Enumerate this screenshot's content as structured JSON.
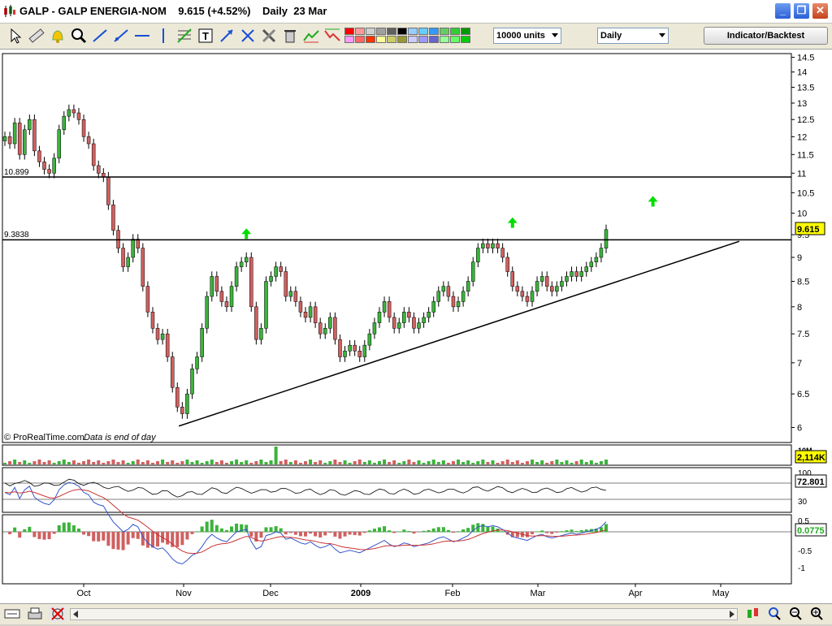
{
  "window": {
    "title": "GALP - GALP ENERGIA-NOM    9.615 (+4.52%)    Daily  23 Mar",
    "minimize_label": "_",
    "restore_label": "❐",
    "close_label": "✕"
  },
  "toolbar": {
    "tools": [
      "pointer-icon",
      "ruler-icon",
      "alarm-bell-icon",
      "zoom-icon",
      "line-tool-icon",
      "ray-tool-icon",
      "horizontal-line-icon",
      "vertical-line-icon",
      "fibonacci-icon",
      "text-tool-icon",
      "arrows-icon",
      "crosshair-icon",
      "tools-icon",
      "trash-icon",
      "trend-up-icon",
      "trend-down-icon"
    ],
    "swatch_colors": [
      "#ff0000",
      "#ff9999",
      "#d0d0d0",
      "#a0a0a0",
      "#606060",
      "#000000",
      "#99ccff",
      "#66ccff",
      "#3399ff",
      "#66cc66",
      "#33cc33",
      "#009900",
      "#ff99ff",
      "#ff6666",
      "#ff3300",
      "#ffff99",
      "#cccc66",
      "#999933",
      "#ccccff",
      "#9999ff",
      "#6666cc",
      "#99ff99",
      "#66ff66",
      "#00cc00"
    ],
    "units_select": "10000 units",
    "period_select": "Daily",
    "indicator_button": "Indicator/Backtest"
  },
  "chart_data": [
    {
      "type": "candlestick",
      "title": "GALP - GALP ENERGIA-NOM",
      "last_price": "9.615",
      "change": "+4.52%",
      "period": "Daily",
      "date_label": "23 Mar",
      "ylim": [
        5.8,
        14.6
      ],
      "y_scale": "log",
      "y_ticks": [
        "14.5",
        "14",
        "13.5",
        "13",
        "12.5",
        "12",
        "11.5",
        "11",
        "10.5",
        "10",
        "9.5",
        "9",
        "8.5",
        "8",
        "7.5",
        "7",
        "6.5",
        "6"
      ],
      "x_labels": [
        "Oct",
        "Nov",
        "Dec",
        "2009",
        "Feb",
        "Mar",
        "Apr",
        "May"
      ],
      "horizontal_lines": [
        {
          "label": "10.899",
          "value": 10.9
        },
        {
          "label": "9.3838",
          "value": 9.3838
        }
      ],
      "trendline": {
        "from": [
          "2008-11-24",
          6.02
        ],
        "to": [
          "2009-04-20",
          9.35
        ]
      },
      "arrow_markers": [
        "2008-11-18",
        "2009-02-16",
        "2009-03-24"
      ],
      "price_badge": "9.615",
      "watermark": "© ProRealTime.com",
      "note": "Data is end of day",
      "close_series": [
        12.0,
        11.8,
        12.4,
        11.5,
        12.2,
        12.5,
        11.6,
        11.3,
        11.1,
        11.0,
        11.4,
        12.2,
        12.6,
        12.8,
        12.7,
        12.5,
        12.0,
        11.8,
        11.2,
        11.0,
        10.9,
        10.2,
        9.6,
        9.2,
        8.8,
        9.0,
        9.4,
        9.2,
        8.4,
        7.9,
        7.6,
        7.4,
        7.5,
        7.1,
        6.6,
        6.3,
        6.2,
        6.5,
        6.9,
        7.1,
        7.6,
        8.2,
        8.6,
        8.3,
        8.1,
        8.0,
        8.4,
        8.8,
        8.9,
        9.0,
        8.0,
        7.4,
        7.6,
        8.5,
        8.6,
        8.8,
        8.7,
        8.2,
        8.3,
        8.1,
        7.9,
        7.8,
        8.0,
        7.7,
        7.5,
        7.6,
        7.8,
        7.4,
        7.1,
        7.2,
        7.3,
        7.2,
        7.1,
        7.3,
        7.5,
        7.7,
        7.9,
        8.1,
        7.8,
        7.6,
        7.7,
        7.9,
        7.8,
        7.6,
        7.7,
        7.8,
        7.9,
        8.1,
        8.3,
        8.4,
        8.2,
        8.0,
        8.1,
        8.3,
        8.5,
        8.9,
        9.2,
        9.3,
        9.2,
        9.3,
        9.2,
        9.0,
        8.7,
        8.4,
        8.3,
        8.2,
        8.1,
        8.3,
        8.5,
        8.6,
        8.4,
        8.3,
        8.4,
        8.5,
        8.6,
        8.7,
        8.6,
        8.7,
        8.8,
        8.9,
        9.0,
        9.2,
        9.615
      ],
      "volume_label": "10M",
      "volume_badge": "2,114K",
      "rsi": {
        "levels": [
          "100",
          "70",
          "30"
        ],
        "badge": "72.801"
      },
      "macd": {
        "ticks": [
          "0.5",
          "-0.5",
          "-1"
        ],
        "badge": "0.0775"
      }
    }
  ],
  "statusbar": {
    "icons": [
      "link-icon",
      "print-icon",
      "no-sync-icon",
      "scroll-left-icon",
      "scroll-right-icon",
      "candle-type-icon",
      "zoom-fit-icon",
      "zoom-out-icon",
      "zoom-in-icon",
      "zoom-reset-icon"
    ]
  }
}
